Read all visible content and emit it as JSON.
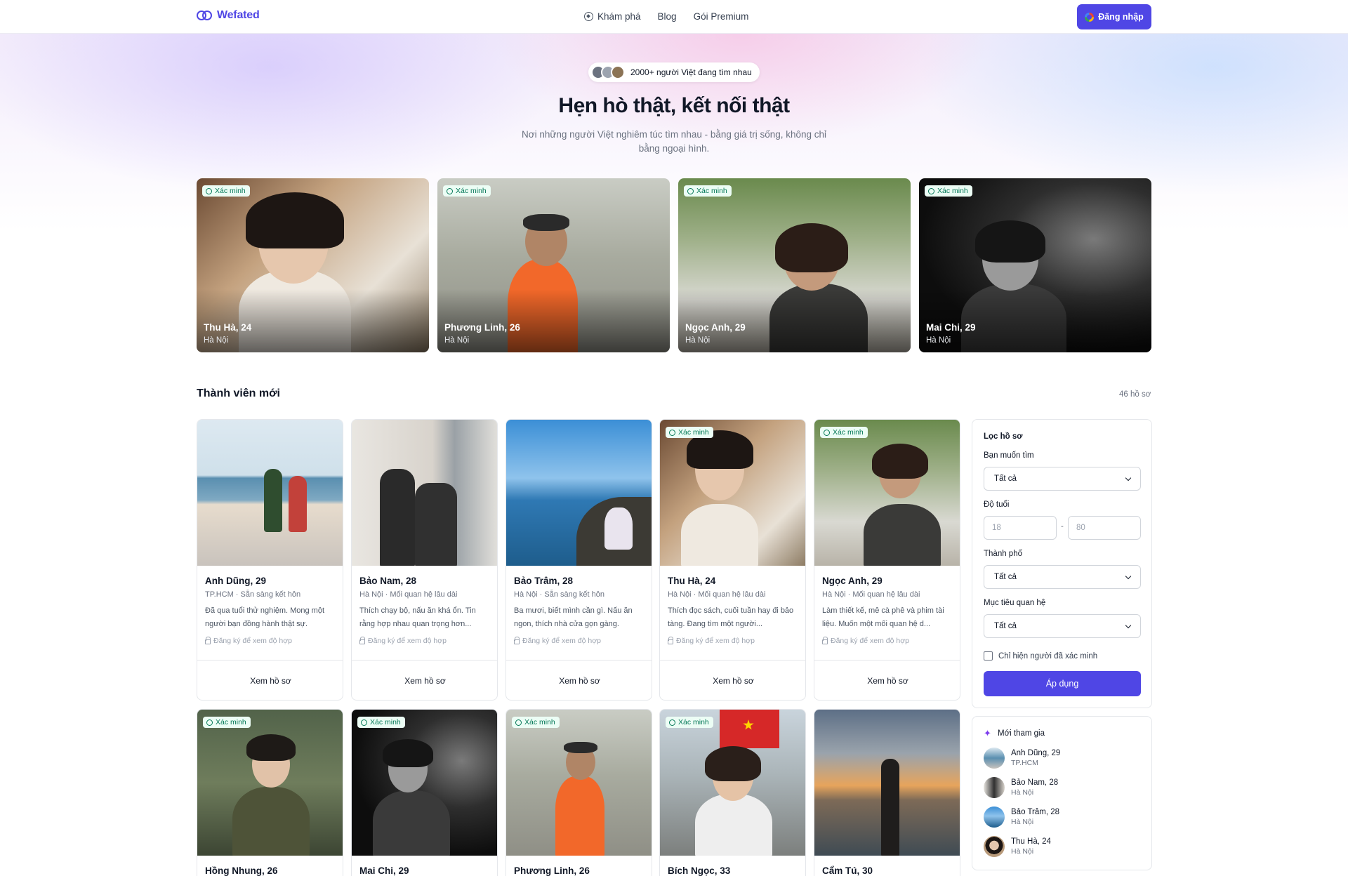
{
  "nav": {
    "brand": "Wefated",
    "links": [
      {
        "label": "Khám phá"
      },
      {
        "label": "Blog"
      },
      {
        "label": "Gói Premium"
      }
    ],
    "login_label": "Đăng nhập"
  },
  "hero": {
    "pill_text": "2000+ người Việt đang tìm nhau",
    "title": "Hẹn hò thật, kết nối thật",
    "subtitle": "Nơi những người Việt nghiêm túc tìm nhau - bằng giá trị sống, không chỉ bằng ngoại hình."
  },
  "verified_label": "Xác minh",
  "featured": [
    {
      "name": "Thu Hà, 24",
      "city": "Hà Nội"
    },
    {
      "name": "Phương Linh, 26",
      "city": "Hà Nội"
    },
    {
      "name": "Ngọc Anh, 29",
      "city": "Hà Nội"
    },
    {
      "name": "Mai Chi, 29",
      "city": "Hà Nội"
    }
  ],
  "members": {
    "title": "Thành viên mới",
    "count": "46 hồ sơ",
    "lock_text": "Đăng ký để xem độ hợp",
    "view_label": "Xem hồ sơ",
    "cards": [
      {
        "name": "Anh Dũng, 29",
        "meta": "TP.HCM · Sẵn sàng kết hôn",
        "bio": "Đã qua tuổi thử nghiệm. Mong một người bạn đồng hành thật sự."
      },
      {
        "name": "Bảo Nam, 28",
        "meta": "Hà Nội · Mối quan hệ lâu dài",
        "bio": "Thích chạy bộ, nấu ăn khá ổn. Tin rằng hợp nhau quan trọng hơn..."
      },
      {
        "name": "Bảo Trâm, 28",
        "meta": "Hà Nội · Sẵn sàng kết hôn",
        "bio": "Ba mươi, biết mình cần gì. Nấu ăn ngon, thích nhà cửa gọn gàng."
      },
      {
        "name": "Thu Hà, 24",
        "meta": "Hà Nội · Mối quan hệ lâu dài",
        "bio": "Thích đọc sách, cuối tuần hay đi bảo tàng. Đang tìm một người..."
      },
      {
        "name": "Ngọc Anh, 29",
        "meta": "Hà Nội · Mối quan hệ lâu dài",
        "bio": "Làm thiết kế, mê cà phê và phim tài liệu. Muốn một mối quan hệ d..."
      }
    ],
    "row2": [
      {
        "name": "Hồng Nhung, 26"
      },
      {
        "name": "Mai Chi, 29"
      },
      {
        "name": "Phương Linh, 26"
      },
      {
        "name": "Bích Ngọc, 33"
      },
      {
        "name": "Cẩm Tú, 30"
      }
    ]
  },
  "filter": {
    "title": "Lọc hồ sơ",
    "looking_for_label": "Bạn muốn tìm",
    "looking_for_value": "Tất cả",
    "age_label": "Độ tuổi",
    "age_min_placeholder": "18",
    "age_dash": "-",
    "age_max_placeholder": "80",
    "city_label": "Thành phố",
    "city_value": "Tất cả",
    "goal_label": "Mục tiêu quan hệ",
    "goal_value": "Tất cả",
    "verified_only_label": "Chỉ hiện người đã xác minh",
    "apply_label": "Áp dụng"
  },
  "new_members": {
    "title": "Mới tham gia",
    "items": [
      {
        "name": "Anh Dũng, 29",
        "city": "TP.HCM"
      },
      {
        "name": "Bảo Nam, 28",
        "city": "Hà Nội"
      },
      {
        "name": "Bảo Trâm, 28",
        "city": "Hà Nội"
      },
      {
        "name": "Thu Hà, 24",
        "city": "Hà Nội"
      }
    ]
  },
  "colors": {
    "accent": "#4f46e5",
    "verified": "#047857"
  }
}
